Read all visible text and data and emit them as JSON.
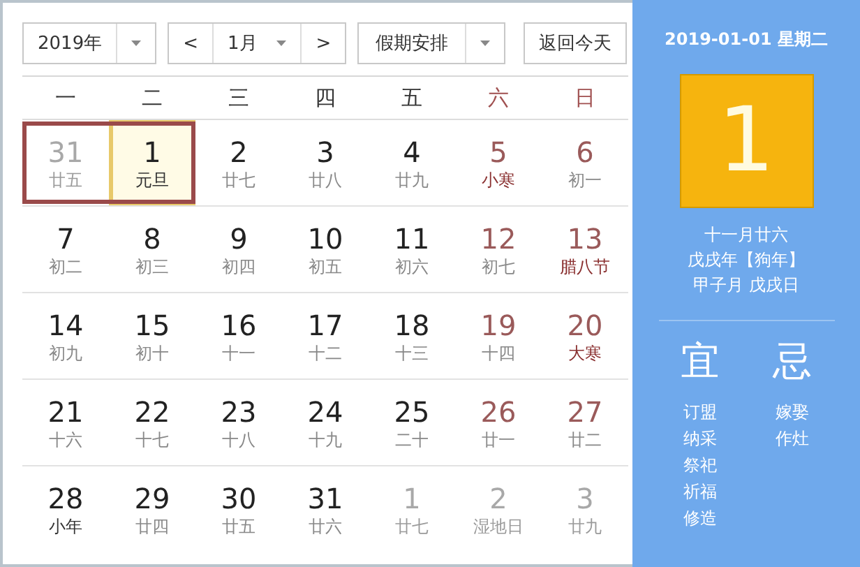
{
  "toolbar": {
    "year": "2019年",
    "prev": "<",
    "month": "1月",
    "next": ">",
    "holiday_select": "假期安排",
    "today_button": "返回今天"
  },
  "weekdays": [
    "一",
    "二",
    "三",
    "四",
    "五",
    "六",
    "日"
  ],
  "weeks": [
    [
      {
        "day": "31",
        "lunar": "廿五",
        "other_month": true,
        "festival": false,
        "holiday": true,
        "selected": false
      },
      {
        "day": "1",
        "lunar": "元旦",
        "other_month": false,
        "festival": true,
        "holiday": true,
        "selected": true
      },
      {
        "day": "2",
        "lunar": "廿七",
        "other_month": false,
        "festival": false,
        "holiday": false,
        "selected": false
      },
      {
        "day": "3",
        "lunar": "廿八",
        "other_month": false,
        "festival": false,
        "holiday": false,
        "selected": false
      },
      {
        "day": "4",
        "lunar": "廿九",
        "other_month": false,
        "festival": false,
        "holiday": false,
        "selected": false
      },
      {
        "day": "5",
        "lunar": "小寒",
        "other_month": false,
        "festival": true,
        "holiday": false,
        "selected": false
      },
      {
        "day": "6",
        "lunar": "初一",
        "other_month": false,
        "festival": false,
        "holiday": false,
        "selected": false
      }
    ],
    [
      {
        "day": "7",
        "lunar": "初二",
        "other_month": false,
        "festival": false,
        "holiday": false,
        "selected": false
      },
      {
        "day": "8",
        "lunar": "初三",
        "other_month": false,
        "festival": false,
        "holiday": false,
        "selected": false
      },
      {
        "day": "9",
        "lunar": "初四",
        "other_month": false,
        "festival": false,
        "holiday": false,
        "selected": false
      },
      {
        "day": "10",
        "lunar": "初五",
        "other_month": false,
        "festival": false,
        "holiday": false,
        "selected": false
      },
      {
        "day": "11",
        "lunar": "初六",
        "other_month": false,
        "festival": false,
        "holiday": false,
        "selected": false
      },
      {
        "day": "12",
        "lunar": "初七",
        "other_month": false,
        "festival": false,
        "holiday": false,
        "selected": false
      },
      {
        "day": "13",
        "lunar": "腊八节",
        "other_month": false,
        "festival": true,
        "holiday": false,
        "selected": false
      }
    ],
    [
      {
        "day": "14",
        "lunar": "初九",
        "other_month": false,
        "festival": false,
        "holiday": false,
        "selected": false
      },
      {
        "day": "15",
        "lunar": "初十",
        "other_month": false,
        "festival": false,
        "holiday": false,
        "selected": false
      },
      {
        "day": "16",
        "lunar": "十一",
        "other_month": false,
        "festival": false,
        "holiday": false,
        "selected": false
      },
      {
        "day": "17",
        "lunar": "十二",
        "other_month": false,
        "festival": false,
        "holiday": false,
        "selected": false
      },
      {
        "day": "18",
        "lunar": "十三",
        "other_month": false,
        "festival": false,
        "holiday": false,
        "selected": false
      },
      {
        "day": "19",
        "lunar": "十四",
        "other_month": false,
        "festival": false,
        "holiday": false,
        "selected": false
      },
      {
        "day": "20",
        "lunar": "大寒",
        "other_month": false,
        "festival": true,
        "holiday": false,
        "selected": false
      }
    ],
    [
      {
        "day": "21",
        "lunar": "十六",
        "other_month": false,
        "festival": false,
        "holiday": false,
        "selected": false
      },
      {
        "day": "22",
        "lunar": "十七",
        "other_month": false,
        "festival": false,
        "holiday": false,
        "selected": false
      },
      {
        "day": "23",
        "lunar": "十八",
        "other_month": false,
        "festival": false,
        "holiday": false,
        "selected": false
      },
      {
        "day": "24",
        "lunar": "十九",
        "other_month": false,
        "festival": false,
        "holiday": false,
        "selected": false
      },
      {
        "day": "25",
        "lunar": "二十",
        "other_month": false,
        "festival": false,
        "holiday": false,
        "selected": false
      },
      {
        "day": "26",
        "lunar": "廿一",
        "other_month": false,
        "festival": false,
        "holiday": false,
        "selected": false
      },
      {
        "day": "27",
        "lunar": "廿二",
        "other_month": false,
        "festival": false,
        "holiday": false,
        "selected": false
      }
    ],
    [
      {
        "day": "28",
        "lunar": "小年",
        "other_month": false,
        "festival": true,
        "holiday": false,
        "selected": false
      },
      {
        "day": "29",
        "lunar": "廿四",
        "other_month": false,
        "festival": false,
        "holiday": false,
        "selected": false
      },
      {
        "day": "30",
        "lunar": "廿五",
        "other_month": false,
        "festival": false,
        "holiday": false,
        "selected": false
      },
      {
        "day": "31",
        "lunar": "廿六",
        "other_month": false,
        "festival": false,
        "holiday": false,
        "selected": false
      },
      {
        "day": "1",
        "lunar": "廿七",
        "other_month": true,
        "festival": false,
        "holiday": false,
        "selected": false
      },
      {
        "day": "2",
        "lunar": "湿地日",
        "other_month": true,
        "festival": false,
        "holiday": false,
        "selected": false
      },
      {
        "day": "3",
        "lunar": "廿九",
        "other_month": true,
        "festival": false,
        "holiday": false,
        "selected": false
      }
    ]
  ],
  "side": {
    "date_line": "2019-01-01 星期二",
    "big_day": "1",
    "lunar_date": "十一月廿六",
    "year_line": "戊戌年【狗年】",
    "ganzhi_line": "甲子月 戊戌日",
    "good": {
      "title": "宜",
      "items": [
        "订盟",
        "纳采",
        "祭祀",
        "祈福",
        "修造"
      ]
    },
    "bad": {
      "title": "忌",
      "items": [
        "嫁娶",
        "作灶"
      ]
    }
  }
}
